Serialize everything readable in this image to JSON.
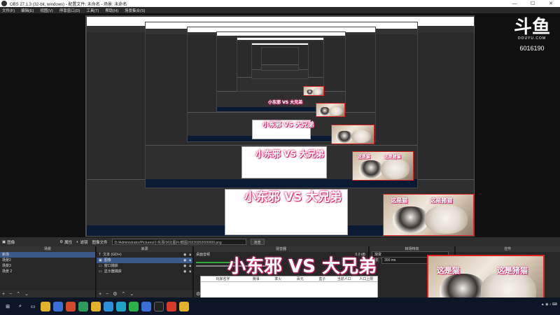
{
  "window": {
    "title": "OBS 27.1.3 (32-bit, windows) - 配置文件: 未命名 - 场景: 未命名",
    "controls": [
      "—",
      "☐",
      "✕"
    ]
  },
  "menu": [
    "文件(F)",
    "编辑(E)",
    "视图(V)",
    "停靠窗口(D)",
    "工具(T)",
    "帮助(H)",
    "场景集合(S)"
  ],
  "preview": {
    "overlay_text": "小东邪 VS 大兄弟",
    "cat_left_label": "这是猫",
    "cat_right_label": "这是猪猫"
  },
  "logo": {
    "mark": "斗鱼",
    "sub": "DOUYU.COM",
    "room": "6016190"
  },
  "source_toolbar": {
    "source_name": "图像",
    "properties": "属性",
    "filters": "滤镜",
    "image_file_label": "图像文件",
    "path": "D:/Administrator/Pictures/小东邪/对比图片/截图20220202000000.png",
    "browse": "浏览"
  },
  "scenes": {
    "header": "场景",
    "items": [
      "新场",
      "场景2",
      "场景3",
      "场景 2"
    ],
    "selected": 0
  },
  "sources": {
    "header": "来源",
    "items": [
      "文本 (GDI+)",
      "图像",
      "窗口捕获",
      "显示器捕获"
    ],
    "selected": 1
  },
  "mixer": {
    "header": "混音器",
    "track": "桌面音频",
    "level": "0.0 dB"
  },
  "transitions": {
    "header": "转场特效",
    "type": "渐变",
    "duration_label": "时长",
    "duration": "300 ms"
  },
  "controls": {
    "header": "控件"
  },
  "table": {
    "headers": [
      "玩家名字",
      "赛事",
      "率火",
      "百元",
      "盒子",
      "当前人口",
      "人口上限"
    ]
  },
  "colors": {
    "accent": "#e0337a",
    "taskbar": "#0c1626",
    "selection": "#3b5a8a"
  }
}
